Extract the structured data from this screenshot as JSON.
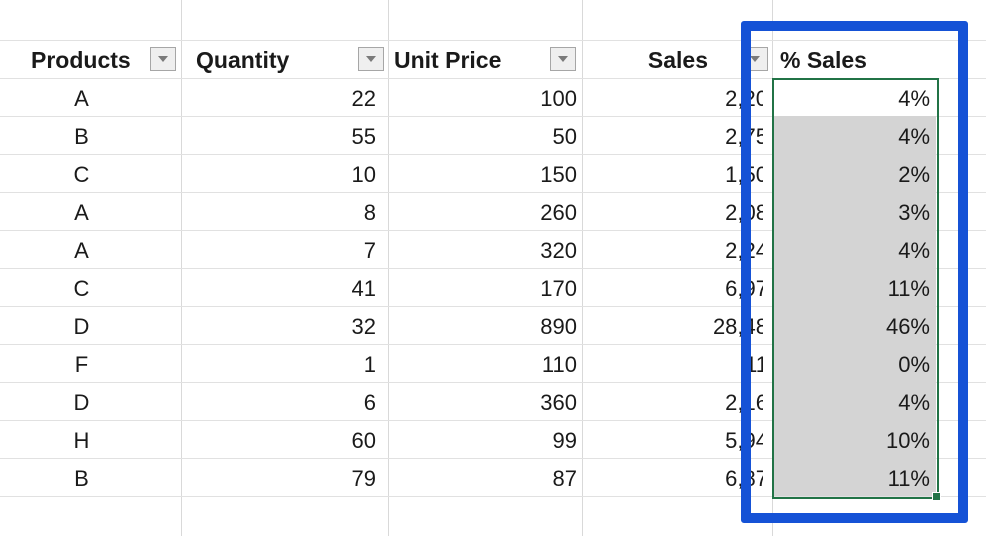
{
  "table": {
    "headers": [
      {
        "label": "Products",
        "align": "left"
      },
      {
        "label": "Quantity",
        "align": "left"
      },
      {
        "label": "Unit Price",
        "align": "left"
      },
      {
        "label": "Sales",
        "align": "right"
      },
      {
        "label": "% Sales",
        "align": "left"
      }
    ],
    "rows": [
      {
        "product": "A",
        "quantity": "22",
        "unit_price": "100",
        "sales": "2,20",
        "pct": "4%"
      },
      {
        "product": "B",
        "quantity": "55",
        "unit_price": "50",
        "sales": "2,75",
        "pct": "4%"
      },
      {
        "product": "C",
        "quantity": "10",
        "unit_price": "150",
        "sales": "1,50",
        "pct": "2%"
      },
      {
        "product": "A",
        "quantity": "8",
        "unit_price": "260",
        "sales": "2,08",
        "pct": "3%"
      },
      {
        "product": "A",
        "quantity": "7",
        "unit_price": "320",
        "sales": "2,24",
        "pct": "4%"
      },
      {
        "product": "C",
        "quantity": "41",
        "unit_price": "170",
        "sales": "6,97",
        "pct": "11%"
      },
      {
        "product": "D",
        "quantity": "32",
        "unit_price": "890",
        "sales": "28,48",
        "pct": "46%"
      },
      {
        "product": "F",
        "quantity": "1",
        "unit_price": "110",
        "sales": "11",
        "pct": "0%"
      },
      {
        "product": "D",
        "quantity": "6",
        "unit_price": "360",
        "sales": "2,16",
        "pct": "4%"
      },
      {
        "product": "H",
        "quantity": "60",
        "unit_price": "99",
        "sales": "5,94",
        "pct": "10%"
      },
      {
        "product": "B",
        "quantity": "79",
        "unit_price": "87",
        "sales": "6,87",
        "pct": "11%"
      }
    ]
  },
  "colors": {
    "highlight": "#1552d6",
    "selection_border": "#217346",
    "selection_fill": "#d4d4d4",
    "gridline": "#d9d9d9"
  },
  "icons": {
    "filter": "dropdown-arrow-icon",
    "fill_handle": "fill-handle"
  }
}
